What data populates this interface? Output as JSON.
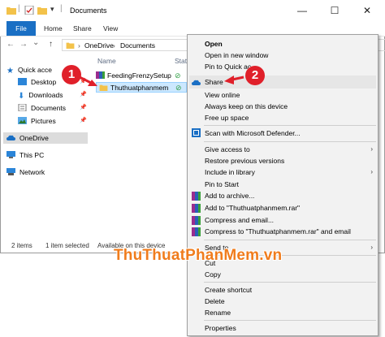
{
  "window": {
    "title": "Documents",
    "controls": {
      "minimize": "—",
      "maximize": "☐",
      "close": "✕"
    }
  },
  "ribbon": {
    "tabs": [
      "File",
      "Home",
      "Share",
      "View"
    ]
  },
  "nav": {
    "back": "←",
    "forward": "→",
    "dropdown": "⌄",
    "up": "↑",
    "breadcrumb": [
      "OneDrive",
      "Documents"
    ],
    "separator": "›"
  },
  "sidebar": {
    "quick_access": "Quick acce",
    "items": [
      "Desktop",
      "Downloads",
      "Documents",
      "Pictures"
    ],
    "pin": "📌",
    "onedrive": "OneDrive",
    "this_pc": "This PC",
    "network": "Network"
  },
  "content": {
    "col_name": "Name",
    "col_status": "Stat",
    "files": [
      {
        "name": "FeedingFrenzySetup",
        "status": "⊘",
        "selected": false
      },
      {
        "name": "Thuthuatphanmem",
        "status": "⊘",
        "selected": true
      }
    ]
  },
  "status_bar": {
    "count": "2 items",
    "selected": "1 item selected",
    "availability": "Available on this device"
  },
  "context_menu": {
    "items": [
      {
        "label": "Open",
        "bold": true
      },
      {
        "label": "Open in new window"
      },
      {
        "label": "Pin to Quick ac"
      },
      {
        "label": "Share",
        "icon": "cloud-icon"
      },
      {
        "label": "View online"
      },
      {
        "label": "Always keep on this device"
      },
      {
        "label": "Free up space"
      },
      {
        "label": "Scan with Microsoft Defender...",
        "icon": "defender-icon"
      },
      {
        "label": "Give access to",
        "submenu": true
      },
      {
        "label": "Restore previous versions"
      },
      {
        "label": "Include in library",
        "submenu": true
      },
      {
        "label": "Pin to Start"
      },
      {
        "label": "Add to archive...",
        "icon": "winrar-icon"
      },
      {
        "label": "Add to \"Thuthuatphanmem.rar\"",
        "icon": "winrar-icon"
      },
      {
        "label": "Compress and email...",
        "icon": "winrar-icon"
      },
      {
        "label": "Compress to \"Thuthuatphanmem.rar\" and email",
        "icon": "winrar-icon"
      },
      {
        "label": "Send to",
        "submenu": true
      },
      {
        "label": "Cut"
      },
      {
        "label": "Copy"
      },
      {
        "label": "Create shortcut"
      },
      {
        "label": "Delete"
      },
      {
        "label": "Rename"
      },
      {
        "label": "Properties"
      }
    ],
    "submenu_arrow": "›"
  },
  "annotations": {
    "step1": "1",
    "step2": "2"
  },
  "watermark": "ThuThuatPhanMem.vn",
  "colors": {
    "accent": "#1a6fc4",
    "selection": "#cce8ff",
    "badge": "#e0202a",
    "watermark": "#f07c1c"
  }
}
